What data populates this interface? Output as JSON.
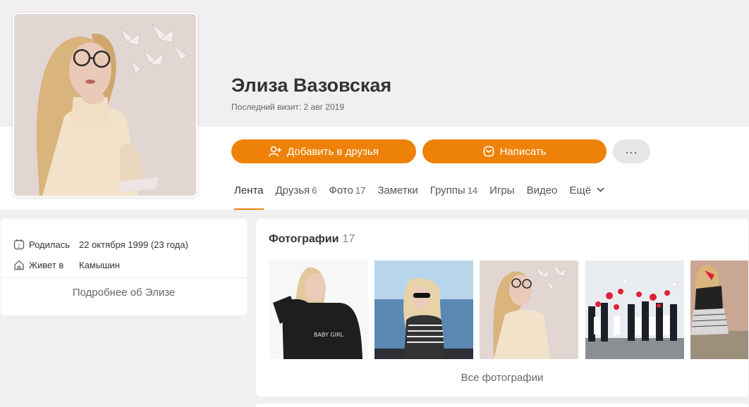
{
  "profile": {
    "name": "Элиза Вазовская",
    "last_visit": "Последний визит: 2 авг 2019"
  },
  "actions": {
    "add_friend_label": "Добавить в друзья",
    "write_label": "Написать",
    "more_label": "..."
  },
  "tabs": [
    {
      "label": "Лента",
      "count": "",
      "active": true
    },
    {
      "label": "Друзья",
      "count": "6"
    },
    {
      "label": "Фото",
      "count": "17"
    },
    {
      "label": "Заметки",
      "count": ""
    },
    {
      "label": "Группы",
      "count": "14"
    },
    {
      "label": "Игры",
      "count": ""
    },
    {
      "label": "Видео",
      "count": ""
    },
    {
      "label": "Ещё",
      "count": ""
    }
  ],
  "info": {
    "born_label": "Родилась",
    "born_value": "22 октября 1999 (23 года)",
    "lives_label": "Живет в",
    "lives_value": "Камышин",
    "more_link": "Подробнее об Элизе"
  },
  "photos": {
    "title": "Фотографии",
    "count": "17",
    "all_link": "Все фотографии",
    "shirt_text": "BABY GIRL"
  },
  "colors": {
    "accent": "#ee8208",
    "background": "#f0f0f0"
  }
}
